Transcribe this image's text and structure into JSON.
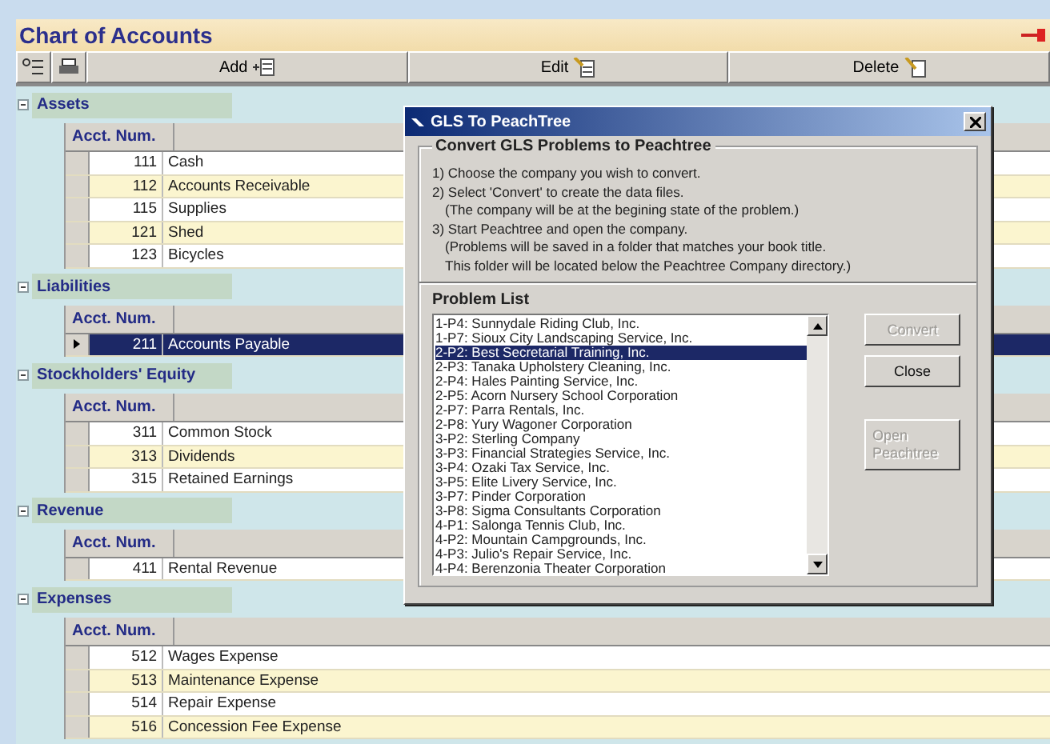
{
  "window": {
    "title": "Chart of Accounts"
  },
  "toolbar": {
    "buttons": [
      {
        "label": "Add",
        "kind": "add"
      },
      {
        "label": "Edit",
        "kind": "edit"
      },
      {
        "label": "Delete",
        "kind": "delete"
      }
    ]
  },
  "groups": [
    {
      "name": "Assets",
      "column_header": "Acct. Num.",
      "rows": [
        {
          "number": "111",
          "name": "Cash",
          "selected": false
        },
        {
          "number": "112",
          "name": "Accounts Receivable",
          "selected": false
        },
        {
          "number": "115",
          "name": "Supplies",
          "selected": false
        },
        {
          "number": "121",
          "name": "Shed",
          "selected": false
        },
        {
          "number": "123",
          "name": "Bicycles",
          "selected": false
        }
      ]
    },
    {
      "name": "Liabilities",
      "column_header": "Acct. Num.",
      "rows": [
        {
          "number": "211",
          "name": "Accounts Payable",
          "selected": true
        }
      ]
    },
    {
      "name": "Stockholders' Equity",
      "column_header": "Acct. Num.",
      "rows": [
        {
          "number": "311",
          "name": "Common Stock",
          "selected": false
        },
        {
          "number": "313",
          "name": "Dividends",
          "selected": false
        },
        {
          "number": "315",
          "name": "Retained Earnings",
          "selected": false
        }
      ]
    },
    {
      "name": "Revenue",
      "column_header": "Acct. Num.",
      "rows": [
        {
          "number": "411",
          "name": "Rental Revenue",
          "selected": false
        }
      ]
    },
    {
      "name": "Expenses",
      "column_header": "Acct. Num.",
      "rows": [
        {
          "number": "512",
          "name": "Wages Expense",
          "selected": false
        },
        {
          "number": "513",
          "name": "Maintenance Expense",
          "selected": false
        },
        {
          "number": "514",
          "name": "Repair Expense",
          "selected": false
        },
        {
          "number": "516",
          "name": "Concession Fee Expense",
          "selected": false
        }
      ]
    }
  ],
  "dialog": {
    "title": "GLS To PeachTree",
    "group_title": "Convert GLS Problems to Peachtree",
    "instructions": [
      {
        "text": "1) Choose the company you wish to convert.",
        "kind": "step"
      },
      {
        "text": "2) Select 'Convert' to create the data files.",
        "kind": "step"
      },
      {
        "text": "(The company will be at the begining state of the problem.)",
        "kind": "note"
      },
      {
        "text": "3) Start Peachtree and open the company.",
        "kind": "step"
      },
      {
        "text": "(Problems will be saved in a folder that matches your book title.",
        "kind": "note"
      },
      {
        "text": "This folder will be located below the Peachtree Company directory.)",
        "kind": "note"
      }
    ],
    "list_title": "Problem List",
    "problems": [
      {
        "label": "1-P4: Sunnydale Riding Club, Inc.",
        "selected": false
      },
      {
        "label": "1-P7: Sioux City Landscaping Service, Inc.",
        "selected": false
      },
      {
        "label": "2-P2: Best Secretarial Training, Inc.",
        "selected": true
      },
      {
        "label": "2-P3: Tanaka Upholstery Cleaning, Inc.",
        "selected": false
      },
      {
        "label": "2-P4: Hales Painting Service, Inc.",
        "selected": false
      },
      {
        "label": "2-P5: Acorn Nursery School Corporation",
        "selected": false
      },
      {
        "label": "2-P7: Parra Rentals, Inc.",
        "selected": false
      },
      {
        "label": "2-P8: Yury Wagoner Corporation",
        "selected": false
      },
      {
        "label": "3-P2: Sterling Company",
        "selected": false
      },
      {
        "label": "3-P3: Financial Strategies Service, Inc.",
        "selected": false
      },
      {
        "label": "3-P4: Ozaki Tax Service, Inc.",
        "selected": false
      },
      {
        "label": "3-P5: Elite Livery Service, Inc.",
        "selected": false
      },
      {
        "label": "3-P7: Pinder Corporation",
        "selected": false
      },
      {
        "label": "3-P8: Sigma Consultants Corporation",
        "selected": false
      },
      {
        "label": "4-P1: Salonga Tennis Club, Inc.",
        "selected": false
      },
      {
        "label": "4-P2: Mountain Campgrounds, Inc.",
        "selected": false
      },
      {
        "label": "4-P3: Julio's Repair Service, Inc.",
        "selected": false
      },
      {
        "label": "4-P4: Berenzonia Theater Corporation",
        "selected": false
      }
    ],
    "buttons": [
      {
        "label": "Convert",
        "disabled": true
      },
      {
        "label": "Close",
        "disabled": false
      },
      {
        "label": "Open Peachtree",
        "disabled": true
      }
    ]
  }
}
